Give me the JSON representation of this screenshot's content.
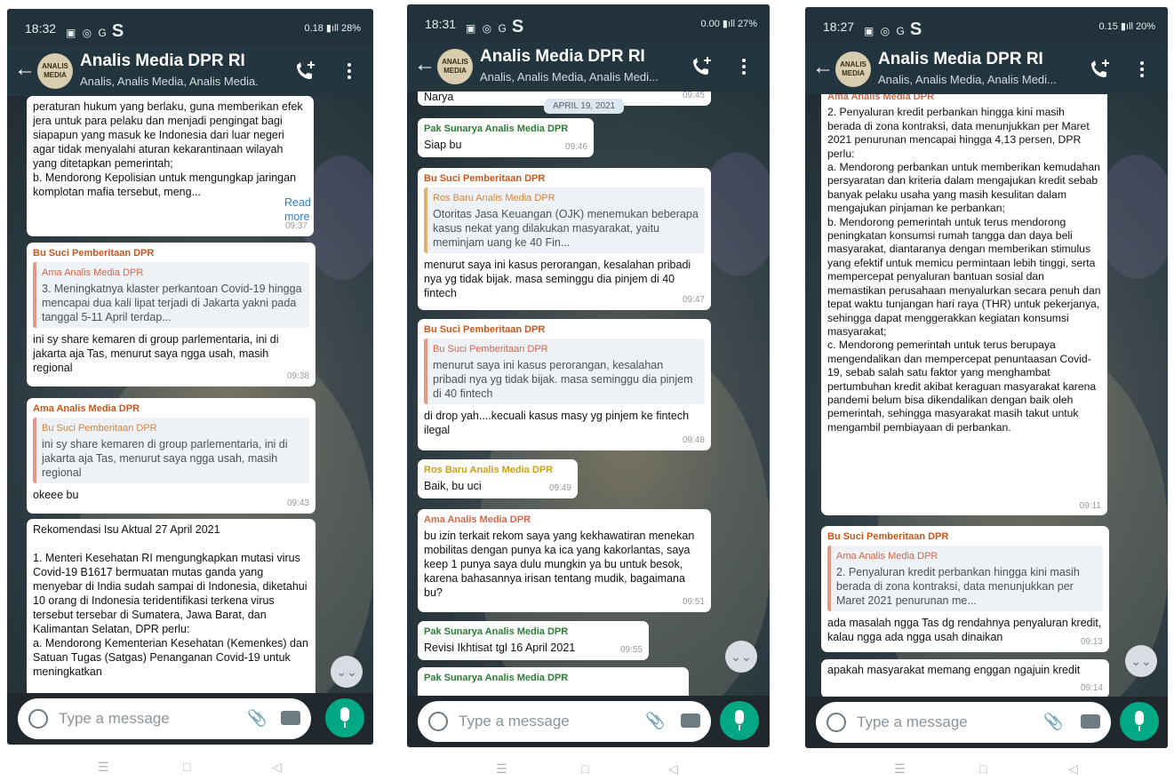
{
  "phones": [
    {
      "status": {
        "time": "18:32",
        "icons": "▣ ◎ G",
        "s_icon": "S",
        "right": "0.18 ▮ıll 28%"
      },
      "header": {
        "title": "Analis Media DPR RI",
        "subtitle": "Analis, Analis Media, Analis Media...",
        "avatar_text": "ANALIS MEDIA"
      },
      "messages": [
        {
          "body": "peraturan hukum yang berlaku, guna memberikan efek jera untuk para pelaku dan menjadi pengingat bagi siapapun yang masuk ke Indonesia dari luar negeri agar tidak menyalahi aturan kekarantinaan wilayah yang ditetapkan pemerintah;\nb. Mendorong Kepolisian untuk mengungkap jaringan komplotan mafia tersebut, meng...",
          "readmore": "Read more",
          "time": "09:37"
        },
        {
          "sender": "Bu Suci Pemberitaan DPR",
          "quote_sender": "Ama Analis Media DPR",
          "quote_text": "3. Meningkatnya klaster perkantoan Covid-19 hingga mencapai dua kali lipat terjadi di Jakarta yakni pada tanggal 5-11 April terdap...",
          "body": "ini sy share kemaren di group parlementaria, ini di jakarta aja Tas, menurut saya ngga usah, masih regional",
          "time": "09:38"
        },
        {
          "sender": "Ama Analis Media DPR",
          "quote_sender": "Bu Suci Pemberitaan DPR",
          "quote_text": "ini sy share kemaren di group parlementaria, ini di jakarta aja Tas, menurut saya ngga usah, masih regional",
          "body": "okeee bu",
          "time": "09:43"
        },
        {
          "body": "Rekomendasi Isu Aktual 27 April 2021\n\n1. Menteri Kesehatan RI mengungkapkan mutasi virus Covid-19 B1617 bermuatan mutas ganda yang menyebar di India sudah sampai di Indonesia, diketahui 10 orang di Indonesia teridentifikasi terkena virus tersebut tersebar di Sumatera, Jawa Barat, dan Kalimantan Selatan, DPR perlu:\na. Mendorong Kementerian Kesehatan (Kemenkes) dan Satuan Tugas (Satgas) Penanganan Covid-19 untuk meningkatkan"
        }
      ],
      "input": {
        "placeholder": "Type a message"
      }
    },
    {
      "status": {
        "time": "18:31",
        "icons": "▣ ◎ G",
        "s_icon": "S",
        "right": "0.00 ▮ıll 27%"
      },
      "header": {
        "title": "Analis Media DPR RI",
        "subtitle": "Analis, Analis Media, Analis Medi...",
        "avatar_text": "ANALIS MEDIA"
      },
      "date_chip": "APRIL 19, 2021",
      "messages": [
        {
          "body": "Narya",
          "time": "09:45"
        },
        {
          "sender": "Pak Sunarya Analis Media DPR",
          "body": "Siap bu",
          "time": "09:46"
        },
        {
          "sender": "Bu Suci Pemberitaan DPR",
          "quote_sender": "Ros Baru Analis Media DPR",
          "quote_text": "Otoritas Jasa Keuangan (OJK) menemukan beberapa kasus nekat yang dilakukan masyarakat, yaitu meminjam uang ke 40 Fin...",
          "body": "menurut saya ini kasus perorangan, kesalahan pribadi nya yg tidak bijak. masa seminggu dia pinjem di 40 fintech",
          "time": "09:47"
        },
        {
          "sender": "Bu Suci Pemberitaan DPR",
          "quote_sender": "Bu Suci Pemberitaan DPR",
          "quote_text": "menurut saya ini kasus perorangan, kesalahan pribadi nya yg tidak bijak. masa seminggu dia pinjem di 40 fintech",
          "body": "di drop yah....kecuali kasus masy yg pinjem ke fintech ilegal",
          "time": "09:48"
        },
        {
          "sender": "Ros Baru Analis Media DPR",
          "body": "Baik, bu uci",
          "time": "09:49"
        },
        {
          "sender": "Ama Analis Media DPR",
          "body": "bu izin terkait rekom saya yang kekhawatiran menekan mobilitas dengan punya ka ica yang kakorlantas, saya keep 1 punya saya dulu mungkin ya bu untuk besok, karena bahasannya irisan tentang mudik, bagaimana bu?",
          "time": "09:51"
        },
        {
          "sender": "Pak Sunarya Analis Media DPR",
          "body": "Revisi Ikhtisat tgl 16 April 2021",
          "time": "09:55"
        },
        {
          "sender": "Pak Sunarya Analis Media DPR",
          "body": ""
        }
      ],
      "input": {
        "placeholder": "Type a message"
      }
    },
    {
      "status": {
        "time": "18:27",
        "icons": "▣ ◎ G",
        "s_icon": "S",
        "right": "0.15 ▮ıll 20%"
      },
      "header": {
        "title": "Analis Media DPR RI",
        "subtitle": "Analis, Analis Media, Analis Medi...",
        "avatar_text": "ANALIS MEDIA"
      },
      "messages": [
        {
          "sender": "Ama Analis Media DPR",
          "body": "2. Penyaluran kredit perbankan hingga kini masih berada di zona kontraksi, data menunjukkan per Maret 2021 penurunan mencapai hingga 4,13 persen, DPR perlu:\na. Mendorong perbankan untuk memberikan kemudahan persyaratan dan kriteria dalam mengajukan kredit sebab banyak pelaku usaha yang masih kesulitan dalam mengajukan pinjaman ke perbankan;\nb. Mendorong pemerintah untuk terus mendorong peningkatan konsumsi rumah tangga dan daya beli masyarakat, diantaranya dengan memberikan stimulus yang efektif untuk memicu permintaan lebih tinggi, serta mempercepat penyaluran bantuan sosial dan memastikan perusahaan menyalurkan secara penuh dan tepat waktu tunjangan hari raya (THR) untuk pekerjanya, sehingga dapat menggerakkan kegiatan konsumsi masyarakat;\nc. Mendorong pemerintah untuk terus berupaya mengendalikan dan mempercepat penuntaasan Covid-19, sebab salah satu faktor yang menghambat pertumbuhan kredit akibat keraguan masyarakat karena pandemi belum bisa dikendalikan dengan baik oleh pemerintah, sehingga masyarakat masih takut untuk mengambil pembiayaan di perbankan.",
          "time": "09:11"
        },
        {
          "sender": "Bu Suci Pemberitaan DPR",
          "quote_sender": "Ama Analis Media DPR",
          "quote_text": "2. Penyaluran kredit perbankan hingga kini masih berada di zona kontraksi, data menunjukkan per Maret 2021 penurunan me...",
          "body": "ada masalah ngga Tas dg rendahnya penyaluran kredit, kalau ngga ada ngga usah dinaikan",
          "time": "09:13"
        },
        {
          "body": "apakah masyarakat memang enggan ngajuin kredit",
          "time": "09:14"
        }
      ],
      "input": {
        "placeholder": "Type a message"
      }
    }
  ],
  "navbar": {
    "menu": "☰",
    "home": "□",
    "back": "◁"
  },
  "scroll_down_icon": "⌄⌄"
}
